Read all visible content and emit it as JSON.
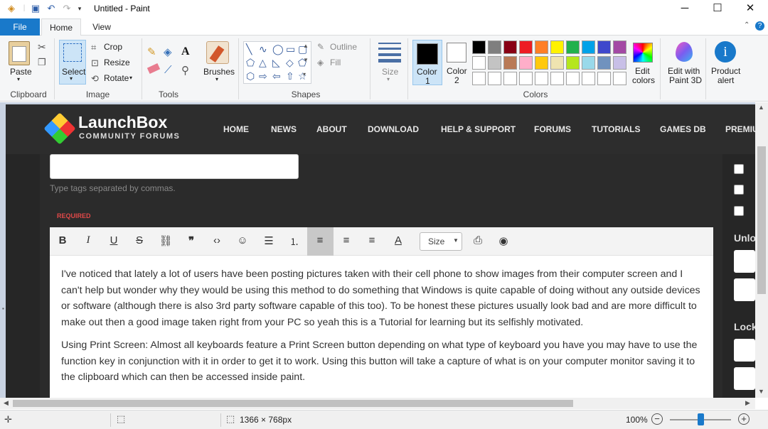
{
  "titlebar": {
    "title": "Untitled - Paint",
    "minimize": "─",
    "maximize": "☐",
    "close": "✕"
  },
  "tabs": {
    "file": "File",
    "home": "Home",
    "view": "View"
  },
  "ribbon": {
    "clipboard": {
      "paste": "Paste",
      "label": "Clipboard"
    },
    "image": {
      "select": "Select",
      "crop": "Crop",
      "resize": "Resize",
      "rotate": "Rotate",
      "label": "Image"
    },
    "tools": {
      "label": "Tools"
    },
    "brushes": "Brushes",
    "shapes": {
      "outline": "Outline",
      "fill": "Fill",
      "label": "Shapes"
    },
    "size": "Size",
    "colors": {
      "color1": "Color",
      "color1_num": "1",
      "color2": "Color",
      "color2_num": "2",
      "edit1": "Edit",
      "edit2": "colors",
      "label": "Colors",
      "palette_row1": [
        "#000000",
        "#7f7f7f",
        "#880015",
        "#ed1c24",
        "#ff7f27",
        "#fff200",
        "#22b14c",
        "#00a2e8",
        "#3f48cc",
        "#a349a4"
      ],
      "palette_row2": [
        "#ffffff",
        "#c3c3c3",
        "#b97a57",
        "#ffaec9",
        "#ffc90e",
        "#efe4b0",
        "#b5e61d",
        "#99d9ea",
        "#7092be",
        "#c8bfe7"
      ]
    },
    "paint3d": {
      "l1": "Edit with",
      "l2": "Paint 3D"
    },
    "product_alert": {
      "l1": "Product",
      "l2": "alert"
    }
  },
  "site": {
    "brand": "LaunchBox",
    "tagline": "COMMUNITY FORUMS",
    "nav": [
      "HOME",
      "NEWS",
      "ABOUT",
      "DOWNLOAD",
      "HELP & SUPPORT",
      "FORUMS",
      "TUTORIALS",
      "GAMES DB",
      "PREMIU"
    ],
    "tags_hint": "Type tags separated by commas.",
    "required": "REQUIRED",
    "size_dropdown": "Size",
    "para1": "I've noticed that lately a lot of users have been posting pictures taken with their cell phone to show images from their computer screen and I can't help but wonder why they would be using this method to do something that Windows is quite capable of doing without any outside devices or software (although there is also 3rd party software capable of this too). To be honest these pictures usually look bad and are more difficult to make out then a good image taken right from your PC so yeah this is a Tutorial for learning but its selfishly motivated.",
    "para2": "Using Print Screen: Almost all keyboards feature a Print Screen button depending on what type of keyboard you have you may have to use the function key in conjunction with it in order to get it to work. Using this button will take a capture of what is on your computer monitor saving it to the clipboard which can then be accessed inside paint.",
    "side1": "Unlo",
    "side2": "Lock"
  },
  "status": {
    "dimensions": "1366 × 768px",
    "zoom": "100%"
  }
}
